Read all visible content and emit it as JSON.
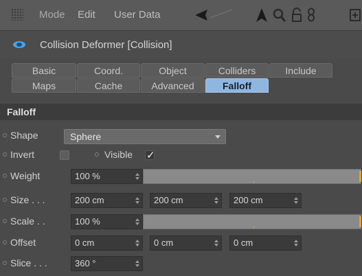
{
  "menubar": {
    "items": [
      "Mode",
      "Edit",
      "User Data"
    ],
    "icons": [
      "back-arrow-icon",
      "up-arrow-icon",
      "search-icon",
      "lock-icon",
      "link-icon",
      "new-panel-icon"
    ]
  },
  "object": {
    "title": "Collision Deformer [Collision]"
  },
  "tabs": {
    "row1": [
      "Basic",
      "Coord.",
      "Object",
      "Colliders",
      "Include"
    ],
    "row2": [
      "Maps",
      "Cache",
      "Advanced",
      "Falloff"
    ],
    "active": "Falloff"
  },
  "section": {
    "title": "Falloff"
  },
  "fields": {
    "shape": {
      "label": "Shape",
      "value": "Sphere"
    },
    "invert": {
      "label": "Invert",
      "checked": false
    },
    "visible": {
      "label": "Visible",
      "checked": true
    },
    "weight": {
      "label": "Weight",
      "value": "100 %",
      "level_pct": 100
    },
    "size": {
      "label": "Size . . .",
      "x": "200 cm",
      "y": "200 cm",
      "z": "200 cm"
    },
    "scale": {
      "label": "Scale . .",
      "value": "100 %",
      "level_pct": 100
    },
    "offset": {
      "label": "Offset",
      "x": "0 cm",
      "y": "0 cm",
      "z": "0 cm"
    },
    "slice": {
      "label": "Slice . . .",
      "value": "360 °"
    }
  },
  "colors": {
    "accent_tab": "#8fb6e0",
    "slider_handle": "#e7a321",
    "object_icon": "#4aa3e8"
  }
}
